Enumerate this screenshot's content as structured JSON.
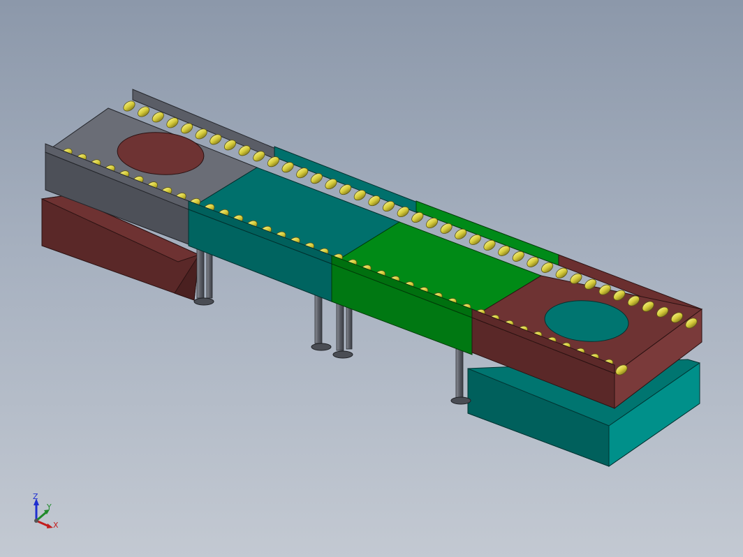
{
  "viewport": {
    "background_top": "#8c98aa",
    "background_bottom": "#c3c9d2"
  },
  "model": {
    "description_free": true,
    "colors": {
      "gray_module": "#4d5058",
      "gray_module_top": "#6a6d76",
      "teal_module": "#006e6a",
      "teal_module_top": "#00706c",
      "green_module": "#007c12",
      "green_module_top": "#008a16",
      "maroon_module": "#6a2d2d",
      "maroon_module_top": "#6e3333",
      "rollers": "#d8cf42",
      "legs": "#6b6e76",
      "teal_base": "#007570",
      "maroon_base": "#5a2828"
    }
  },
  "triad": {
    "icon": "coordinate-triad-icon",
    "z_label": "Z",
    "y_label": "Y",
    "x_label": "X",
    "colors": {
      "z": "#1f2fd0",
      "y": "#1f8a2a",
      "x": "#c21d1d"
    }
  }
}
